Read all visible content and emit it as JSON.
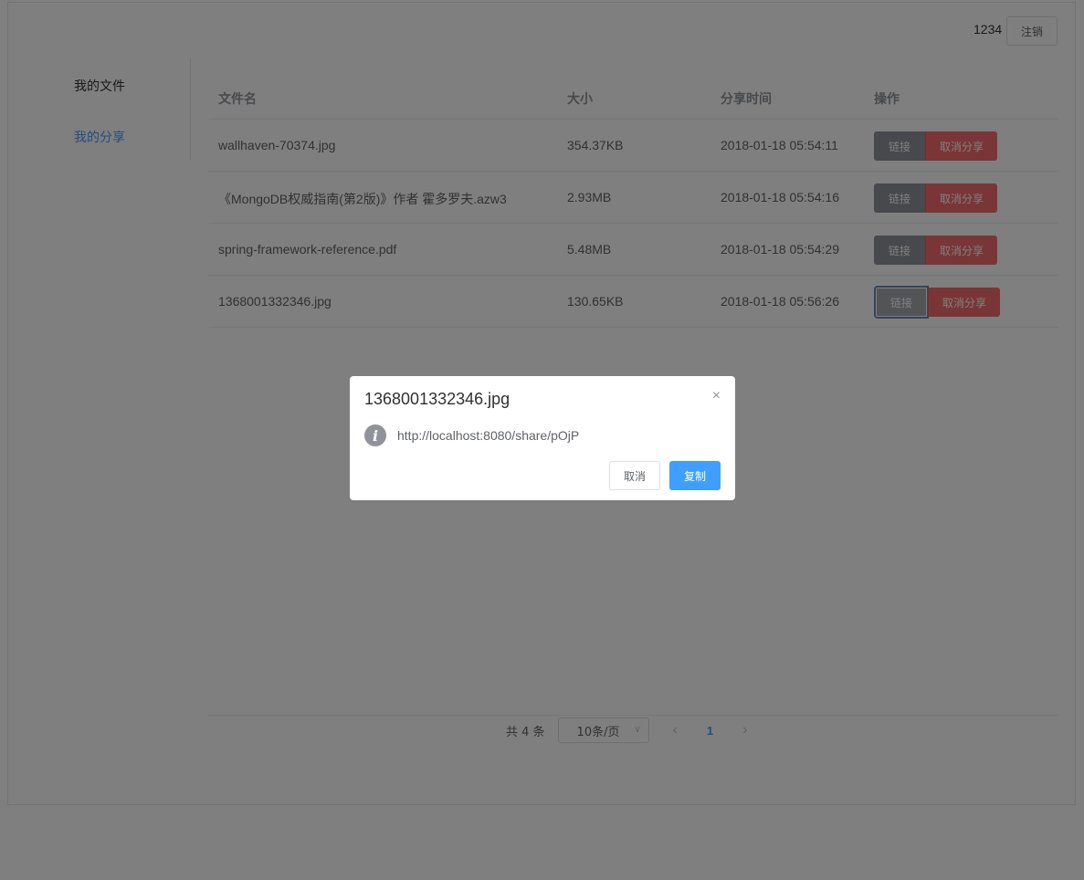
{
  "header": {
    "username": "1234",
    "logout_label": "注销"
  },
  "sidebar": {
    "items": [
      {
        "label": "我的文件",
        "active": false
      },
      {
        "label": "我的分享",
        "active": true
      }
    ]
  },
  "table": {
    "columns": [
      "文件名",
      "大小",
      "分享时间",
      "操作"
    ],
    "rows": [
      {
        "name": "wallhaven-70374.jpg",
        "size": "354.37KB",
        "time": "2018-01-18 05:54:11"
      },
      {
        "name": "《MongoDB权威指南(第2版)》作者 霍多罗夫.azw3",
        "size": "2.93MB",
        "time": "2018-01-18 05:54:16"
      },
      {
        "name": "spring-framework-reference.pdf",
        "size": "5.48MB",
        "time": "2018-01-18 05:54:29"
      },
      {
        "name": "1368001332346.jpg",
        "size": "130.65KB",
        "time": "2018-01-18 05:56:26"
      }
    ],
    "link_label": "链接",
    "cancel_share_label": "取消分享"
  },
  "pagination": {
    "total_text": "共 4 条",
    "page_size": "10条/页",
    "current_page": "1",
    "prev_icon": "‹",
    "next_icon": "›"
  },
  "dialog": {
    "title": "1368001332346.jpg",
    "message": "http://localhost:8080/share/pOjP",
    "cancel_label": "取消",
    "copy_label": "复制",
    "close_icon": "×",
    "info_icon": "i"
  },
  "colors": {
    "primary": "#409eff",
    "danger": "#f56c6c",
    "info": "#909399",
    "overlay": "rgba(0,0,0,0.5)"
  }
}
